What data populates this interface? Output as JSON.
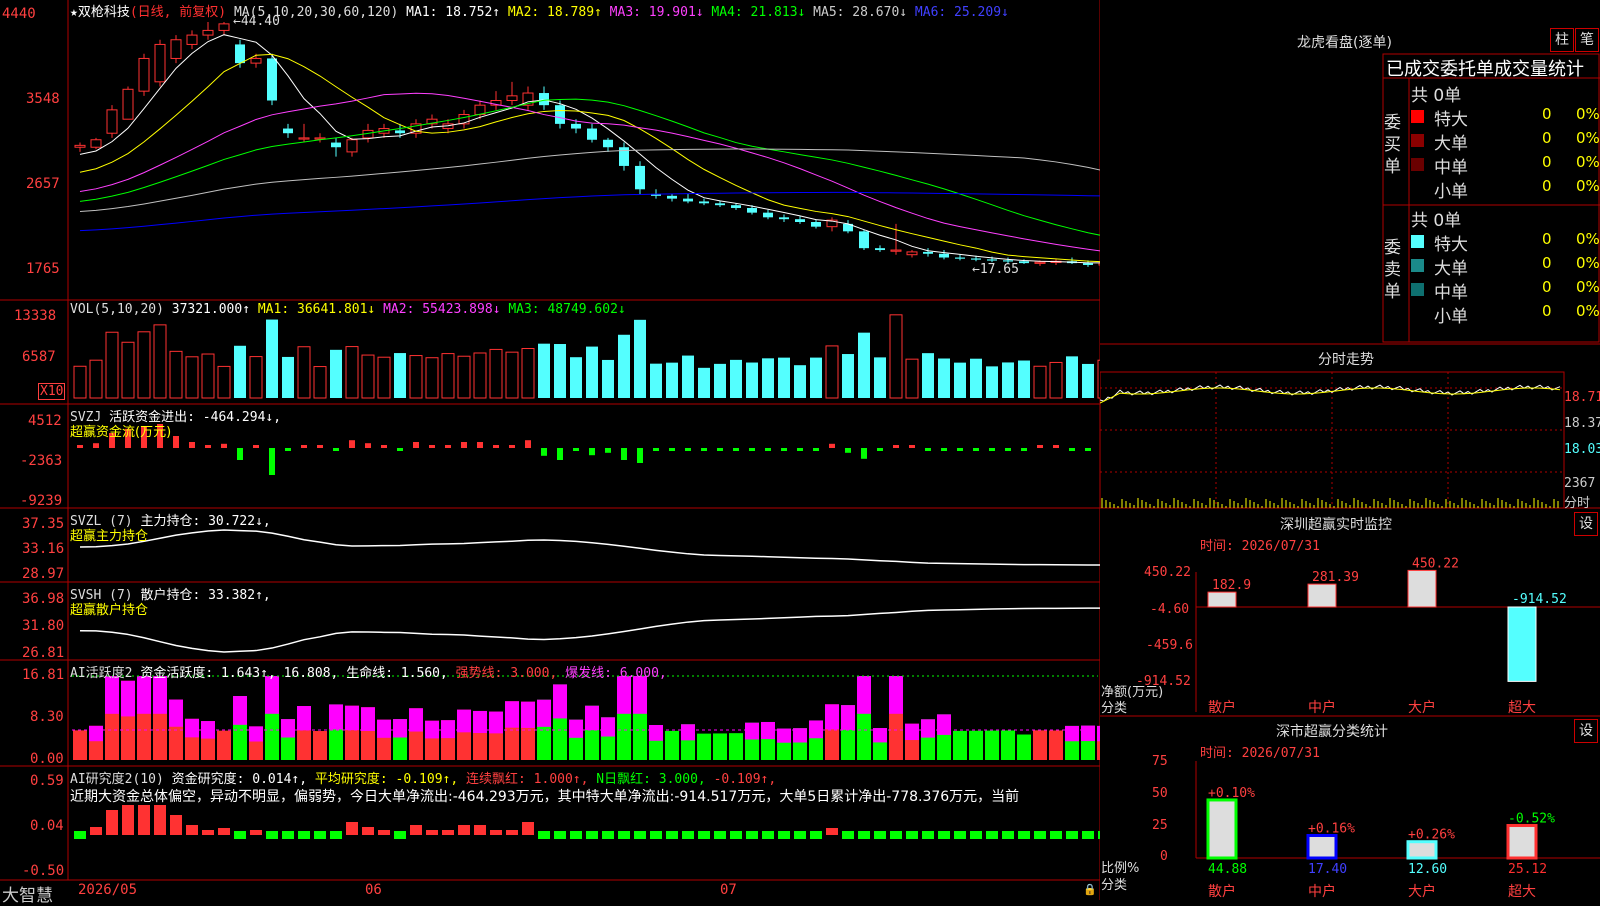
{
  "stock": {
    "title": "★双枪科技",
    "mode": "(日线, 前复权)"
  },
  "colors": {
    "up": "#ff3232",
    "down": "#54ffff",
    "border": "#b00000",
    "axis_text": "#ff4040",
    "ma1": "#ffffff",
    "ma2": "#ffff00",
    "ma3": "#ff40ff",
    "ma4": "#00ff00",
    "ma5": "#c0c0c0",
    "ma6": "#0000ff",
    "green": "#00ff00",
    "magenta": "#ff00ff",
    "yellow": "#ffff00"
  },
  "kline": {
    "ma_label": "MA(5,10,20,30,60,120)",
    "ma_values": [
      {
        "text": "MA1: 18.752↑",
        "color": "#ffffff"
      },
      {
        "text": "MA2: 18.789↑",
        "color": "#ffff00"
      },
      {
        "text": "MA3: 19.901↓",
        "color": "#ff40ff"
      },
      {
        "text": "MA4: 21.813↓",
        "color": "#00ff00"
      },
      {
        "text": "MA5: 28.670↓",
        "color": "#c0c0c0"
      },
      {
        "text": "MA6: 25.209↓",
        "color": "#4040ff"
      }
    ],
    "y_ticks": [
      "4440",
      "3548",
      "2657",
      "1765"
    ],
    "high_label": "←44.40",
    "low_label": "←17.65"
  },
  "volume": {
    "label": "VOL(5,10,20)",
    "value": "37321.000↑",
    "ma1": "MA1: 36641.801↓",
    "ma2": "MA2: 55423.898↓",
    "ma3": "MA3: 48749.602↓",
    "y_ticks": [
      "13338",
      "6587"
    ],
    "unit": "X10"
  },
  "svzj": {
    "label": "SVZJ",
    "value": "活跃资金进出: -464.294↓,",
    "subtitle": "超赢资金流(万元)",
    "y_ticks": [
      "4512",
      "-2363",
      "-9239"
    ]
  },
  "svzl": {
    "label": "SVZL (7)",
    "value": "主力持仓: 30.722↓,",
    "subtitle": "超赢主力持仓",
    "y_ticks": [
      "37.35",
      "33.16",
      "28.97"
    ]
  },
  "svsh": {
    "label": "SVSH (7)",
    "value": "散户持仓: 33.382↑,",
    "subtitle": "超赢散户持仓",
    "y_ticks": [
      "36.98",
      "31.80",
      "26.81"
    ]
  },
  "ai_active": {
    "label": "AI活跃度2",
    "value": "资金活跃度: 1.643↑, 16.808,",
    "life": "生命线: 1.560,",
    "strong": "强势线: 3.000,",
    "burst": "爆发线: 6.000,",
    "y_ticks": [
      "16.81",
      "8.30",
      "0.00"
    ]
  },
  "ai_research": {
    "label": "AI研究度2(10)",
    "value": "资金研究度: 0.014↑,",
    "avg": "平均研究度: -0.109↑,",
    "cont": "连续飘红: 1.000↑,",
    "nday": "N日飘红: 3.000,",
    "last": "-0.109↑,",
    "comment": "近期大资金总体偏空，异动不明显，偏弱势，今日大单净流出:-464.293万元，其中特大单净流出:-914.517万元，大单5日累计净出-778.376万元，当前",
    "y_ticks": [
      "0.59",
      "0.04",
      "-0.50"
    ]
  },
  "xaxis": {
    "brand": "大智慧",
    "labels": [
      "2026/05",
      "06",
      "07"
    ]
  },
  "right": {
    "top_title": "龙虎看盘(逐单)",
    "btn_bar": "柱",
    "btn_pen": "笔",
    "header": "已成交委托单成交量统计",
    "buy_side": "委买单",
    "sell_side": "委卖单",
    "buy_total": "共 0单",
    "sell_total": "共 0单",
    "rows": [
      {
        "label": "特大",
        "value": "0",
        "pct": "0%"
      },
      {
        "label": "大单",
        "value": "0",
        "pct": "0%"
      },
      {
        "label": "中单",
        "value": "0",
        "pct": "0%"
      },
      {
        "label": "小单",
        "value": "0",
        "pct": "0%"
      }
    ],
    "intraday_title": "分时走势",
    "intraday_ticks": [
      "18.71",
      "18.37",
      "18.03"
    ],
    "intraday_vol": "2367",
    "intraday_vol_label": "分时",
    "realtime_title": "深圳超赢实时监控",
    "realtime_time": "时间: 2026/07/31",
    "set_btn": "设",
    "realtime_ticks": [
      "450.22",
      "-4.60",
      "-459.6",
      "-914.52"
    ],
    "realtime_ylabel": "净额(万元)",
    "realtime_xlabel": "分类",
    "classify_title": "深市超赢分类统计",
    "classify_time": "时间: 2026/07/31",
    "classify_ticks": [
      "75",
      "50",
      "25",
      "0"
    ],
    "classify_ylabel": "比例%",
    "classify_xlabel": "分类"
  },
  "chart_data": [
    {
      "type": "bar",
      "title": "深圳超赢实时监控",
      "categories": [
        "散户",
        "中户",
        "大户",
        "超大"
      ],
      "values": [
        182.9,
        281.39,
        450.22,
        -914.52
      ],
      "value_labels": [
        "182.9",
        "281.39",
        "450.22",
        "-914.52"
      ],
      "ylabel": "净额(万元)",
      "xlabel": "分类",
      "ylim": [
        -914.52,
        450.22
      ]
    },
    {
      "type": "bar",
      "title": "深市超赢分类统计",
      "categories": [
        "散户",
        "中户",
        "大户",
        "超大"
      ],
      "values": [
        44.88,
        17.4,
        12.6,
        25.12
      ],
      "value_labels": [
        "44.88",
        "17.40",
        "12.60",
        "25.12"
      ],
      "change_labels": [
        "+0.10%",
        "+0.16%",
        "+0.26%",
        "-0.52%"
      ],
      "ylabel": "比例%",
      "xlabel": "分类",
      "ylim": [
        0,
        75
      ]
    },
    {
      "type": "line",
      "title": "K线 (candlestick)",
      "ylim": [
        17.65,
        44.4
      ],
      "candles_ohlc": [
        [
          31.0,
          31.5,
          30.5,
          31.2
        ],
        [
          31.0,
          32.0,
          30.8,
          31.8
        ],
        [
          32.5,
          35.5,
          32.0,
          35.0
        ],
        [
          34.0,
          37.5,
          34.0,
          37.2
        ],
        [
          37.0,
          41.0,
          36.5,
          40.5
        ],
        [
          38.0,
          42.5,
          37.5,
          42.0
        ],
        [
          40.5,
          43.0,
          40.0,
          42.5
        ],
        [
          42.0,
          43.5,
          41.5,
          43.0
        ],
        [
          43.0,
          44.4,
          42.5,
          43.5
        ],
        [
          43.5,
          44.4,
          43.0,
          44.2
        ],
        [
          42.0,
          42.5,
          39.5,
          40.0
        ],
        [
          40.0,
          41.0,
          39.5,
          40.5
        ],
        [
          40.5,
          41.0,
          35.5,
          36.0
        ],
        [
          33.0,
          33.5,
          32.0,
          32.5
        ],
        [
          32.0,
          33.5,
          31.5,
          32.0
        ],
        [
          32.0,
          32.5,
          31.5,
          32.0
        ],
        [
          31.5,
          32.0,
          30.0,
          31.0
        ],
        [
          30.5,
          32.0,
          30.0,
          31.8
        ],
        [
          32.0,
          33.5,
          31.5,
          32.8
        ],
        [
          32.5,
          33.5,
          32.0,
          33.0
        ],
        [
          32.8,
          33.5,
          32.0,
          32.5
        ],
        [
          32.5,
          34.0,
          32.0,
          33.5
        ],
        [
          33.5,
          34.5,
          33.0,
          34.0
        ],
        [
          33.0,
          34.0,
          32.5,
          33.5
        ],
        [
          33.5,
          35.0,
          33.0,
          34.5
        ],
        [
          34.5,
          36.0,
          34.0,
          35.5
        ],
        [
          35.5,
          37.0,
          35.0,
          36.0
        ],
        [
          36.0,
          38.0,
          35.5,
          36.5
        ],
        [
          35.5,
          37.5,
          35.0,
          36.8
        ],
        [
          36.8,
          37.5,
          35.0,
          35.5
        ],
        [
          35.5,
          36.0,
          33.0,
          33.5
        ],
        [
          33.5,
          34.0,
          32.5,
          33.0
        ],
        [
          33.0,
          33.5,
          31.5,
          31.8
        ],
        [
          31.8,
          32.0,
          30.5,
          31.0
        ],
        [
          31.0,
          31.5,
          28.5,
          29.0
        ],
        [
          29.0,
          29.5,
          26.0,
          26.5
        ],
        [
          26.0,
          26.5,
          25.5,
          25.8
        ],
        [
          25.8,
          26.0,
          25.2,
          25.5
        ],
        [
          25.5,
          26.0,
          25.0,
          25.2
        ],
        [
          25.2,
          25.5,
          24.8,
          25.0
        ],
        [
          25.0,
          25.3,
          24.6,
          24.8
        ],
        [
          24.8,
          25.0,
          24.3,
          24.5
        ],
        [
          24.5,
          24.8,
          23.8,
          24.0
        ],
        [
          24.0,
          24.3,
          23.3,
          23.5
        ],
        [
          23.5,
          23.8,
          23.0,
          23.3
        ],
        [
          23.3,
          23.6,
          22.8,
          23.0
        ],
        [
          23.0,
          23.3,
          22.3,
          22.5
        ],
        [
          22.5,
          23.5,
          22.0,
          23.2
        ],
        [
          22.8,
          23.2,
          21.8,
          22.0
        ],
        [
          22.0,
          22.2,
          20.0,
          20.2
        ],
        [
          20.2,
          20.5,
          19.8,
          20.0
        ],
        [
          20.0,
          22.8,
          19.5,
          20.0
        ],
        [
          19.5,
          20.0,
          19.2,
          19.8
        ],
        [
          19.8,
          20.2,
          19.3,
          19.6
        ],
        [
          19.6,
          20.0,
          19.0,
          19.2
        ],
        [
          19.2,
          19.5,
          18.9,
          19.1
        ],
        [
          19.1,
          19.4,
          18.8,
          19.0
        ],
        [
          19.0,
          19.3,
          18.7,
          18.9
        ],
        [
          18.9,
          19.2,
          18.6,
          18.8
        ],
        [
          18.8,
          19.0,
          18.5,
          18.6
        ],
        [
          18.6,
          18.9,
          18.3,
          18.7
        ],
        [
          18.7,
          19.0,
          18.4,
          18.8
        ],
        [
          18.8,
          19.2,
          18.5,
          18.6
        ],
        [
          18.6,
          18.9,
          18.2,
          18.4
        ],
        [
          18.4,
          18.8,
          18.1,
          18.6
        ],
        [
          18.6,
          18.9,
          18.3,
          18.5
        ],
        [
          18.5,
          18.9,
          18.0,
          18.8
        ]
      ]
    }
  ]
}
